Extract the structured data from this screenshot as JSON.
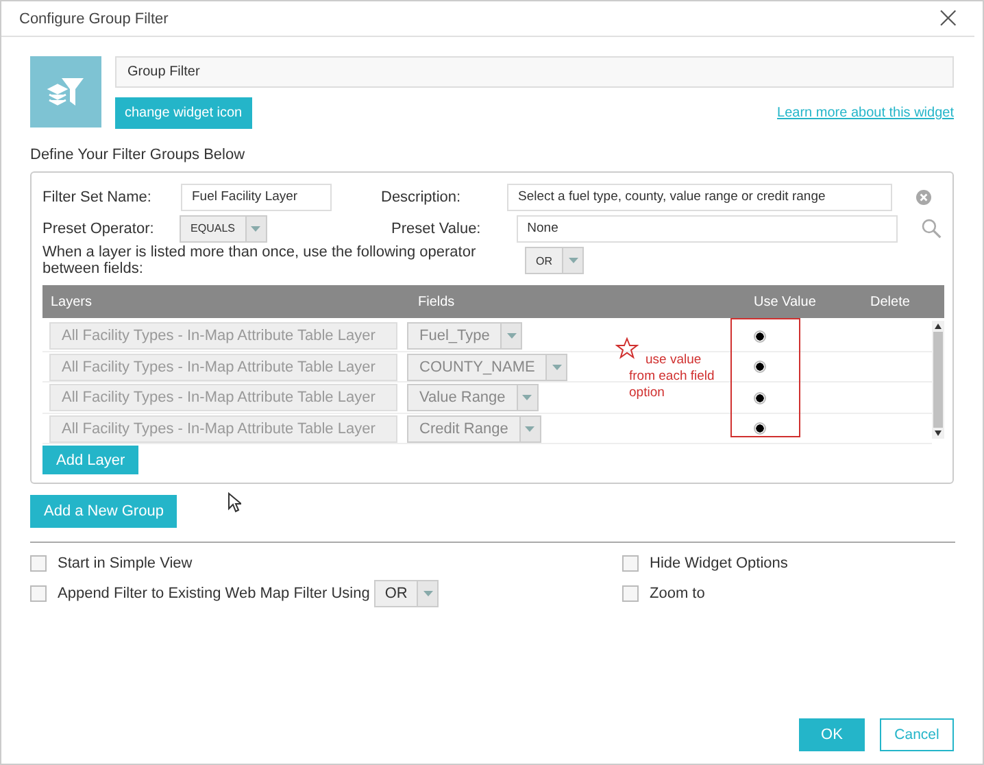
{
  "window": {
    "title": "Configure Group Filter",
    "close": "×"
  },
  "widget": {
    "name": "Group Filter",
    "change_icon_button": "change widget icon",
    "learn_more_link": "Learn more about this widget"
  },
  "section_title": "Define Your Filter Groups Below",
  "group": {
    "filter_set_name_label": "Filter Set Name:",
    "filter_set_name": "Fuel Facility Layer",
    "description_label": "Description:",
    "description": "Select a fuel type, county, value range or credit range",
    "preset_operator_label": "Preset Operator:",
    "preset_operator": "EQUALS",
    "preset_value_label": "Preset Value:",
    "preset_value": "None",
    "operator_note": "When a layer is listed more than once, use the following operator between fields:",
    "between_operator": "OR",
    "table": {
      "columns": [
        "Layers",
        "Fields",
        "Use Value",
        "Delete"
      ],
      "rows": [
        {
          "layer": "All Facility Types - In-Map Attribute Table Layer",
          "field": "Fuel_Type",
          "use_value": true
        },
        {
          "layer": "All Facility Types - In-Map Attribute Table Layer",
          "field": "COUNTY_NAME",
          "use_value": true
        },
        {
          "layer": "All Facility Types - In-Map Attribute Table Layer",
          "field": "Value Range",
          "use_value": true
        },
        {
          "layer": "All Facility Types - In-Map Attribute Table Layer",
          "field": "Credit Range",
          "use_value": true
        }
      ]
    },
    "annotation": "use value from each field option",
    "add_layer_button": "Add Layer"
  },
  "add_group_button": "Add a New Group",
  "options": [
    {
      "label": "Start in Simple View",
      "checked": false
    },
    {
      "label": "Hide Widget Options",
      "checked": false
    },
    {
      "label": "Append Filter to Existing Web Map Filter Using",
      "checked": false,
      "operator": "OR"
    },
    {
      "label": "Zoom to",
      "checked": false
    }
  ],
  "buttons": {
    "ok": "OK",
    "cancel": "Cancel"
  }
}
